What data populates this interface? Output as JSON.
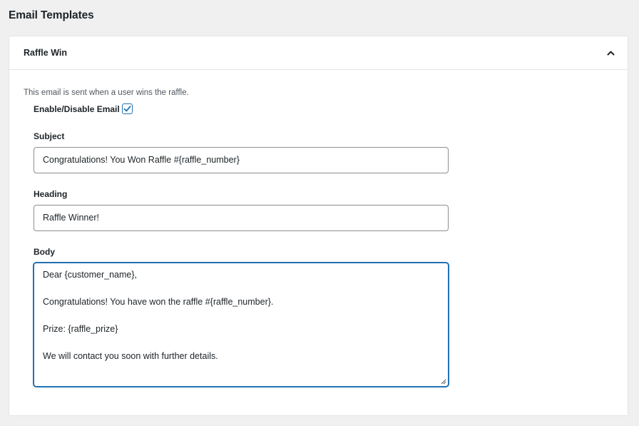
{
  "page": {
    "title": "Email Templates"
  },
  "card": {
    "title": "Raffle Win",
    "toggle_icon": "chevron-up-icon",
    "description": "This email is sent when a user wins the raffle.",
    "enable": {
      "label": "Enable/Disable Email",
      "checked": true
    },
    "subject": {
      "label": "Subject",
      "value": "Congratulations! You Won Raffle #{raffle_number}"
    },
    "heading": {
      "label": "Heading",
      "value": "Raffle Winner!"
    },
    "body": {
      "label": "Body",
      "lines": [
        "Dear {customer_name},",
        "Congratulations! You have won the raffle #{raffle_number}.",
        "Prize: {raffle_prize}",
        "We will contact you soon with further details."
      ]
    }
  },
  "colors": {
    "accent": "#2271b1",
    "background": "#f0f0f1",
    "card": "#ffffff",
    "border": "#e2e4e7",
    "input_border": "#8c8f94",
    "text": "#1d2327",
    "muted_text": "#50575e"
  }
}
